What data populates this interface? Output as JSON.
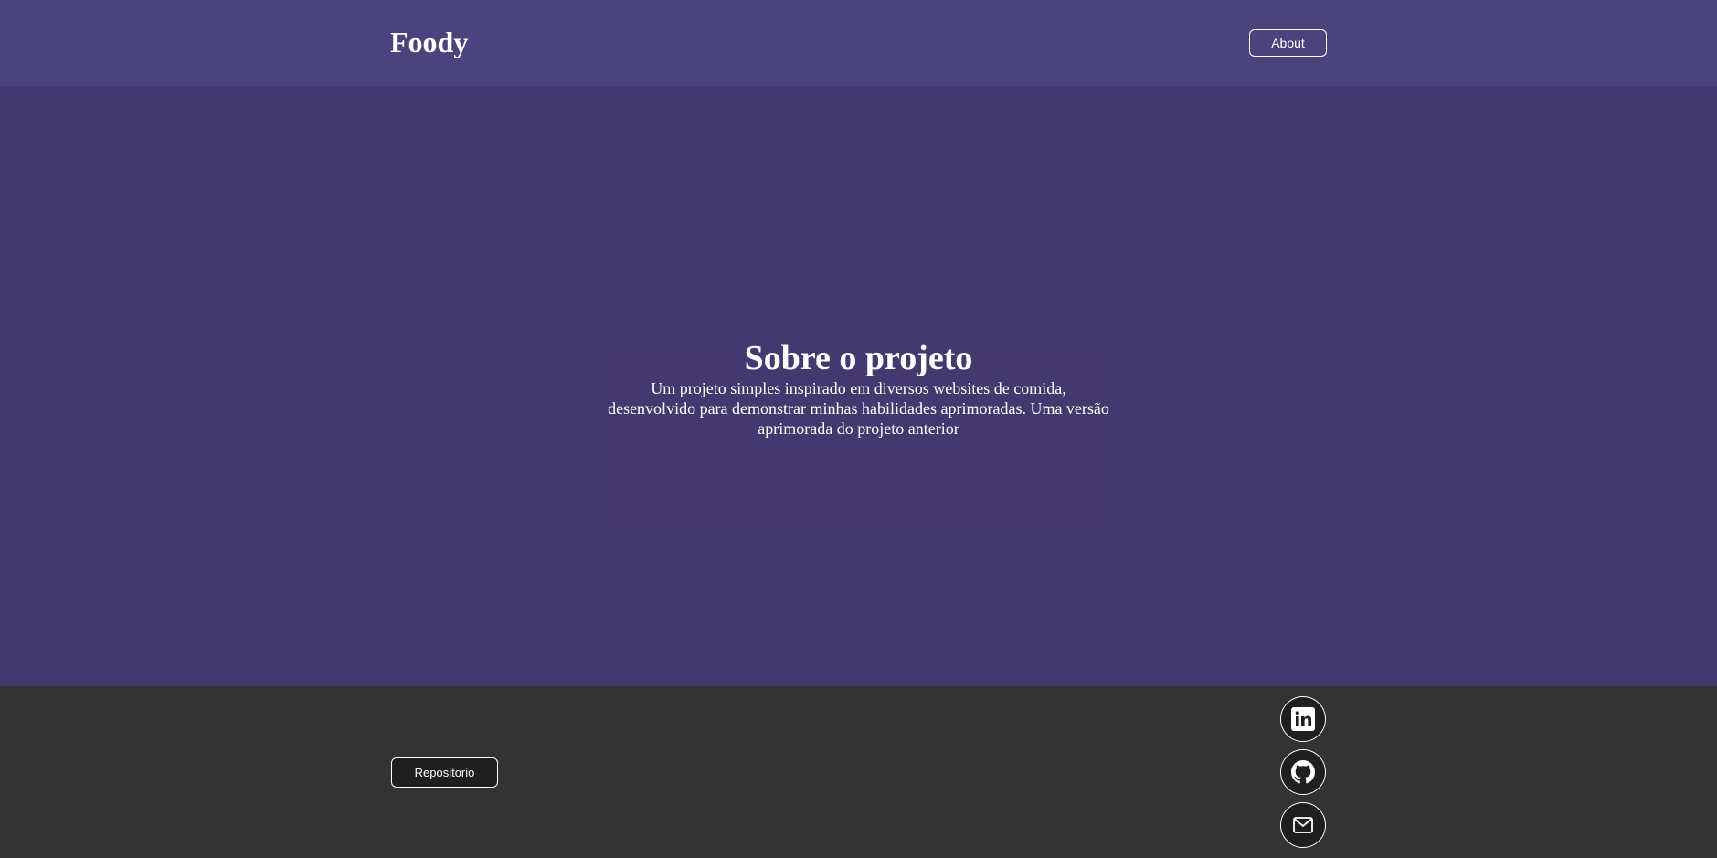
{
  "header": {
    "logo": "Foody",
    "about_label": "About"
  },
  "main": {
    "title": "Sobre o projeto",
    "description": "Um projeto simples inspirado em diversos websites de comida, desenvolvido para demonstrar minhas habilidades aprimoradas. Uma versão aprimorada do projeto anterior"
  },
  "footer": {
    "repo_label": "Repositorio",
    "social": [
      {
        "icon": "linkedin-icon"
      },
      {
        "icon": "github-icon"
      },
      {
        "icon": "email-icon"
      }
    ]
  },
  "colors": {
    "header_bg": "#4b437d",
    "main_bg": "#433a6f",
    "footer_bg": "#333333",
    "text": "#ffffff"
  }
}
